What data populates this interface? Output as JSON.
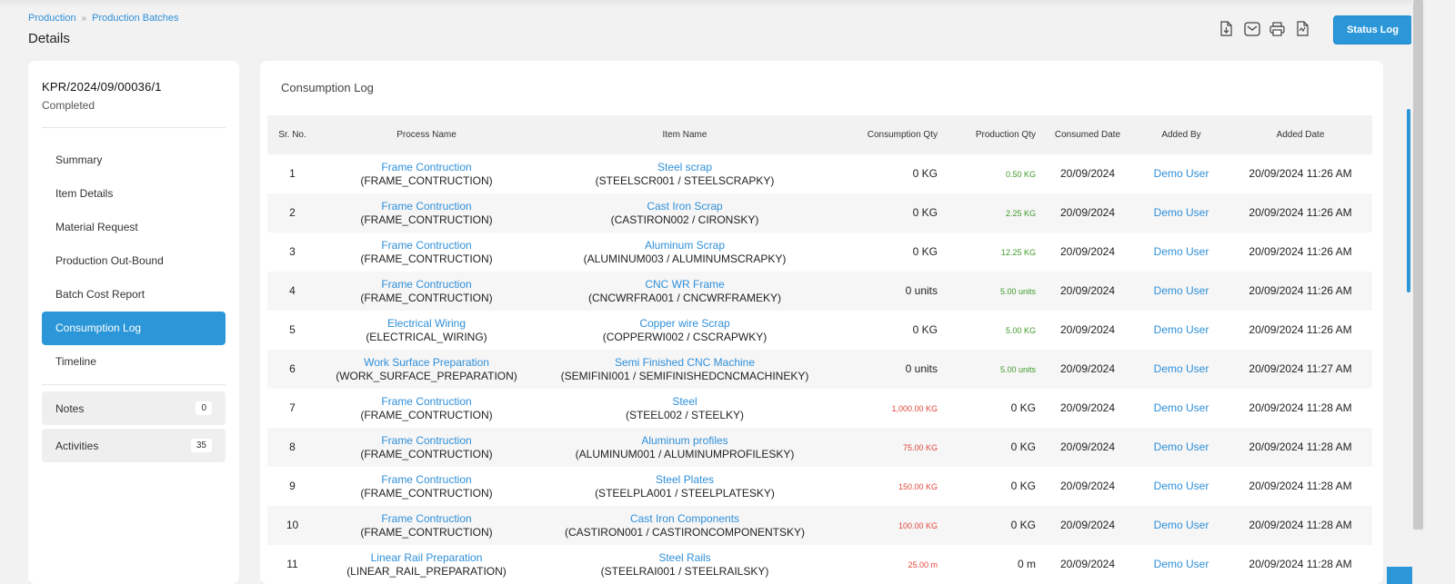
{
  "breadcrumb": {
    "items": [
      "Production",
      "Production Batches"
    ]
  },
  "page_title": "Details",
  "toolbar": {
    "icons": [
      "file-export-icon",
      "mail-icon",
      "print-icon",
      "pdf-icon"
    ],
    "status_log_label": "Status Log"
  },
  "batch": {
    "id": "KPR/2024/09/00036/1",
    "status": "Completed"
  },
  "sidebar": {
    "items": [
      {
        "label": "Summary",
        "active": false
      },
      {
        "label": "Item Details",
        "active": false
      },
      {
        "label": "Material Request",
        "active": false
      },
      {
        "label": "Production Out-Bound",
        "active": false
      },
      {
        "label": "Batch Cost Report",
        "active": false
      },
      {
        "label": "Consumption Log",
        "active": true
      },
      {
        "label": "Timeline",
        "active": false
      }
    ],
    "notes": {
      "label": "Notes",
      "count": "0"
    },
    "activities": {
      "label": "Activities",
      "count": "35"
    }
  },
  "section_title": "Consumption Log",
  "table": {
    "headers": [
      "Sr. No.",
      "Process Name",
      "Item Name",
      "Consumption Qty",
      "Production Qty",
      "Consumed Date",
      "Added By",
      "Added Date"
    ],
    "rows": [
      {
        "sr": "1",
        "process": "Frame Contruction",
        "process_code": "(FRAME_CONTRUCTION)",
        "item": "Steel scrap",
        "item_code": "(STEELSCR001 / STEELSCRAPKY)",
        "consumption": "0 KG",
        "consumption_type": "plain",
        "production": "0.50 KG",
        "production_type": "green",
        "consumed_date": "20/09/2024",
        "added_by": "Demo User",
        "added_date": "20/09/2024 11:26 AM"
      },
      {
        "sr": "2",
        "process": "Frame Contruction",
        "process_code": "(FRAME_CONTRUCTION)",
        "item": "Cast Iron Scrap",
        "item_code": "(CASTIRON002 / CIRONSKY)",
        "consumption": "0 KG",
        "consumption_type": "plain",
        "production": "2.25 KG",
        "production_type": "green",
        "consumed_date": "20/09/2024",
        "added_by": "Demo User",
        "added_date": "20/09/2024 11:26 AM"
      },
      {
        "sr": "3",
        "process": "Frame Contruction",
        "process_code": "(FRAME_CONTRUCTION)",
        "item": "Aluminum Scrap",
        "item_code": "(ALUMINUM003 / ALUMINUMSCRAPKY)",
        "consumption": "0 KG",
        "consumption_type": "plain",
        "production": "12.25 KG",
        "production_type": "green",
        "consumed_date": "20/09/2024",
        "added_by": "Demo User",
        "added_date": "20/09/2024 11:26 AM"
      },
      {
        "sr": "4",
        "process": "Frame Contruction",
        "process_code": "(FRAME_CONTRUCTION)",
        "item": "CNC WR Frame",
        "item_code": "(CNCWRFRA001 / CNCWRFRAMEKY)",
        "consumption": "0 units",
        "consumption_type": "plain",
        "production": "5.00 units",
        "production_type": "green",
        "consumed_date": "20/09/2024",
        "added_by": "Demo User",
        "added_date": "20/09/2024 11:26 AM"
      },
      {
        "sr": "5",
        "process": "Electrical Wiring",
        "process_code": "(ELECTRICAL_WIRING)",
        "item": "Copper wire Scrap",
        "item_code": "(COPPERWI002 / CSCRAPWKY)",
        "consumption": "0 KG",
        "consumption_type": "plain",
        "production": "5.00 KG",
        "production_type": "green",
        "consumed_date": "20/09/2024",
        "added_by": "Demo User",
        "added_date": "20/09/2024 11:26 AM"
      },
      {
        "sr": "6",
        "process": "Work Surface Preparation",
        "process_code": "(WORK_SURFACE_PREPARATION)",
        "item": "Semi Finished CNC Machine",
        "item_code": "(SEMIFINI001 / SEMIFINISHEDCNCMACHINEKY)",
        "consumption": "0 units",
        "consumption_type": "plain",
        "production": "5.00 units",
        "production_type": "green",
        "consumed_date": "20/09/2024",
        "added_by": "Demo User",
        "added_date": "20/09/2024 11:27 AM"
      },
      {
        "sr": "7",
        "process": "Frame Contruction",
        "process_code": "(FRAME_CONTRUCTION)",
        "item": "Steel",
        "item_code": "(STEEL002 / STEELKY)",
        "consumption": "1,000.00 KG",
        "consumption_type": "red",
        "production": "0 KG",
        "production_type": "plain",
        "consumed_date": "20/09/2024",
        "added_by": "Demo User",
        "added_date": "20/09/2024 11:28 AM"
      },
      {
        "sr": "8",
        "process": "Frame Contruction",
        "process_code": "(FRAME_CONTRUCTION)",
        "item": "Aluminum profiles",
        "item_code": "(ALUMINUM001 / ALUMINUMPROFILESKY)",
        "consumption": "75.00 KG",
        "consumption_type": "red",
        "production": "0 KG",
        "production_type": "plain",
        "consumed_date": "20/09/2024",
        "added_by": "Demo User",
        "added_date": "20/09/2024 11:28 AM"
      },
      {
        "sr": "9",
        "process": "Frame Contruction",
        "process_code": "(FRAME_CONTRUCTION)",
        "item": "Steel Plates",
        "item_code": "(STEELPLA001 / STEELPLATESKY)",
        "consumption": "150.00 KG",
        "consumption_type": "red",
        "production": "0 KG",
        "production_type": "plain",
        "consumed_date": "20/09/2024",
        "added_by": "Demo User",
        "added_date": "20/09/2024 11:28 AM"
      },
      {
        "sr": "10",
        "process": "Frame Contruction",
        "process_code": "(FRAME_CONTRUCTION)",
        "item": "Cast Iron Components",
        "item_code": "(CASTIRON001 / CASTIRONCOMPONENTSKY)",
        "consumption": "100.00 KG",
        "consumption_type": "red",
        "production": "0 KG",
        "production_type": "plain",
        "consumed_date": "20/09/2024",
        "added_by": "Demo User",
        "added_date": "20/09/2024 11:28 AM"
      },
      {
        "sr": "11",
        "process": "Linear Rail Preparation",
        "process_code": "(LINEAR_RAIL_PREPARATION)",
        "item": "Steel Rails",
        "item_code": "(STEELRAI001 / STEELRAILSKY)",
        "consumption": "25.00 m",
        "consumption_type": "red",
        "production": "0 m",
        "production_type": "plain",
        "consumed_date": "20/09/2024",
        "added_by": "Demo User",
        "added_date": "20/09/2024 11:28 AM"
      }
    ]
  },
  "colors": {
    "accent": "#2b97d9",
    "link": "#2f8fd8",
    "positive": "#3f9a2a",
    "negative": "#e0473b"
  }
}
